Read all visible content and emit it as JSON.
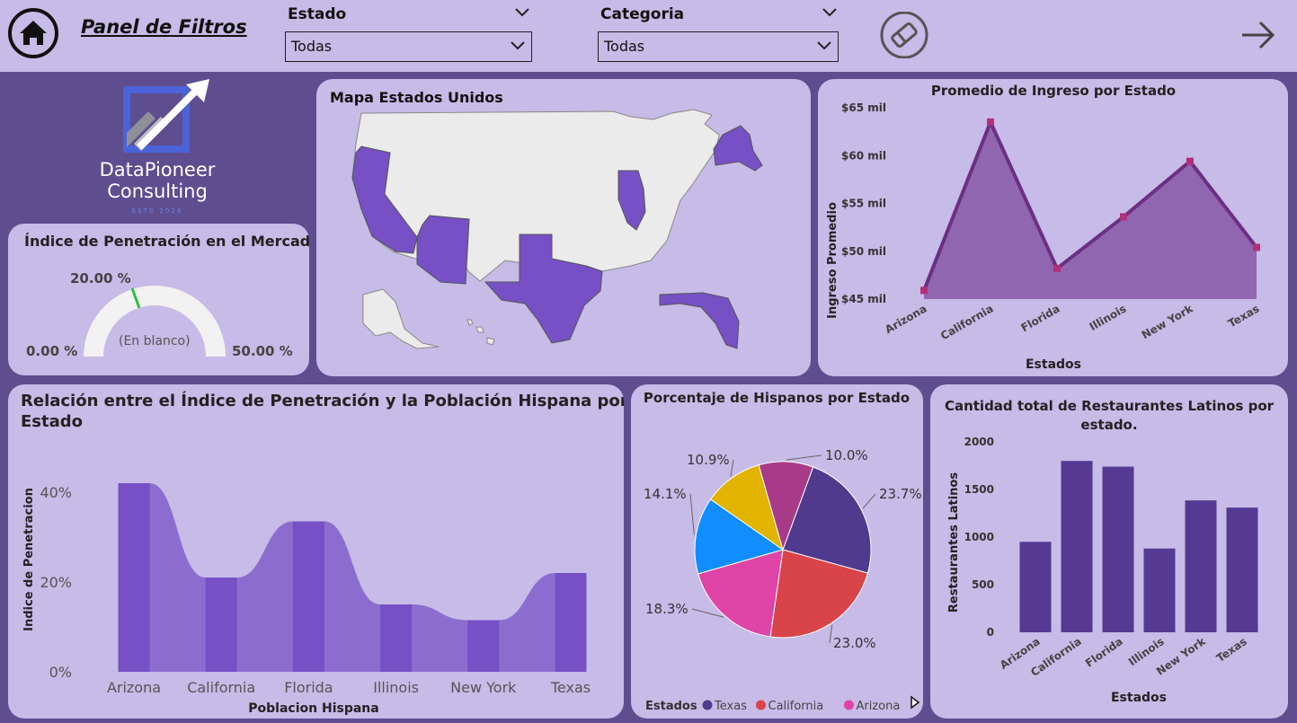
{
  "header": {
    "title": "Panel de Filtros",
    "filters": [
      {
        "label": "Estado",
        "value": "Todas"
      },
      {
        "label": "Categoria",
        "value": "Todas"
      }
    ]
  },
  "logo": {
    "name_line1": "DataPioneer",
    "name_line2": "Consulting",
    "estd": "ESTD 2024"
  },
  "gauge": {
    "title": "Índice de Penetración en el Mercado",
    "target_label": "20.00 %",
    "min_label": "0.00 %",
    "max_label": "50.00 %",
    "value_label": "(En blanco)",
    "min": 0,
    "max": 50,
    "target": 20
  },
  "map": {
    "title": "Mapa Estados Unidos",
    "highlighted_states": [
      "California",
      "Arizona",
      "Texas",
      "Illinois",
      "Florida",
      "New York"
    ],
    "highlight_color": "#7650c4"
  },
  "chart_data": [
    {
      "type": "area",
      "title": "Promedio de Ingreso por Estado",
      "xlabel": "Estados",
      "ylabel": "Ingreso Promedio",
      "categories": [
        "Arizona",
        "California",
        "Florida",
        "Illinois",
        "New York",
        "Texas"
      ],
      "values": [
        45.9,
        63.5,
        48.2,
        53.6,
        59.4,
        50.4
      ],
      "y_ticks": [
        "$45 mil",
        "$50 mil",
        "$55 mil",
        "$60 mil",
        "$65 mil"
      ],
      "ylim": [
        45,
        65
      ]
    },
    {
      "type": "bar",
      "title": "Relación entre el Índice de Penetración y la Población Hispana por Estado",
      "xlabel": "Poblacion Hispana",
      "ylabel": "Indice de Penetracion",
      "categories": [
        "Arizona",
        "California",
        "Florida",
        "Illinois",
        "New York",
        "Texas"
      ],
      "values": [
        42,
        21,
        33.5,
        15,
        11.5,
        22
      ],
      "y_ticks": [
        "0%",
        "20%",
        "40%"
      ],
      "ylim": [
        0,
        44
      ]
    },
    {
      "type": "pie",
      "title": "Porcentaje de Hispanos por Estado",
      "legend_title": "Estados",
      "slices": [
        {
          "label": "Texas",
          "value": 23.7,
          "text": "23.7%",
          "color": "#4f3a8d"
        },
        {
          "label": "California",
          "value": 23.0,
          "text": "23.0%",
          "color": "#d9434a"
        },
        {
          "label": "Arizona",
          "value": 18.3,
          "text": "18.3%",
          "color": "#e044a7"
        },
        {
          "label": "",
          "value": 14.1,
          "text": "14.1%",
          "color": "#118dff"
        },
        {
          "label": "",
          "value": 10.9,
          "text": "10.9%",
          "color": "#e0b400"
        },
        {
          "label": "",
          "value": 10.0,
          "text": "10.0%",
          "color": "#a83b87"
        }
      ]
    },
    {
      "type": "bar",
      "title_line1": "Cantidad total de Restaurantes Latinos por",
      "title_line2": "estado.",
      "xlabel": "Estados",
      "ylabel": "Restaurantes Latinos",
      "categories": [
        "Arizona",
        "California",
        "Florida",
        "Illinois",
        "New York",
        "Texas"
      ],
      "values": [
        950,
        1800,
        1740,
        880,
        1385,
        1310
      ],
      "y_ticks": [
        "0",
        "500",
        "1000",
        "1500",
        "2000"
      ],
      "ylim": [
        0,
        2000
      ]
    }
  ]
}
